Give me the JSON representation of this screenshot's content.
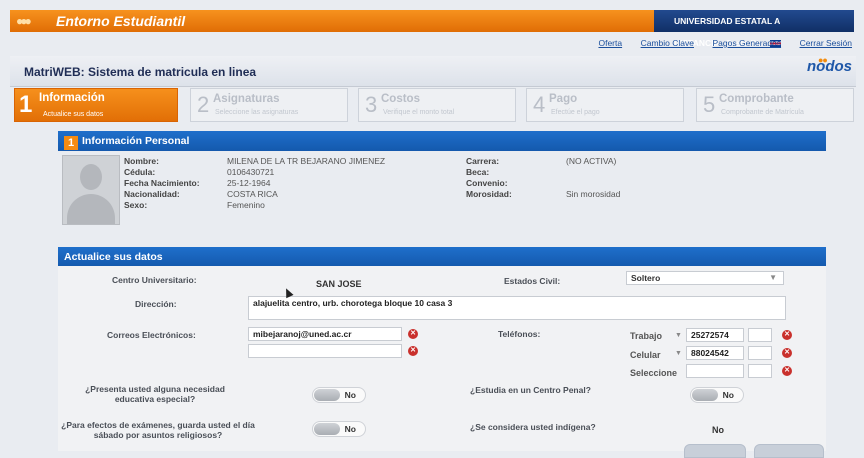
{
  "app": {
    "title": "Entorno Estudiantil",
    "university": "UNIVERSIDAD ESTATAL A DISTANCIA",
    "country": "Costa Rica",
    "brand_orange": "#f08512",
    "brand_blue": "#1a63bd"
  },
  "top_links": [
    "Oferta",
    "Cambio Clave",
    "Pagos Generados",
    "Cerrar Sesión"
  ],
  "header": {
    "title": "MatriWEB: Sistema de matricula en linea",
    "logo": "nodos"
  },
  "steps": [
    {
      "num": "1",
      "label": "Información",
      "sub": "Actualice sus datos",
      "active": true
    },
    {
      "num": "2",
      "label": "Asignaturas",
      "sub": "Seleccione las asignaturas",
      "active": false
    },
    {
      "num": "3",
      "label": "Costos",
      "sub": "Verifique el monto total",
      "active": false
    },
    {
      "num": "4",
      "label": "Pago",
      "sub": "Efectúe el pago",
      "active": false
    },
    {
      "num": "5",
      "label": "Comprobante",
      "sub": "Comprobante de Matrícula",
      "active": false
    }
  ],
  "personal": {
    "section_num": "1",
    "heading": "Información Personal",
    "labels": [
      "Nombre:",
      "Cédula:",
      "Fecha Nacimiento:",
      "Nacionalidad:",
      "Sexo:"
    ],
    "values": [
      "MILENA DE LA TR BEJARANO JIMENEZ",
      "0106430721",
      "25-12-1964",
      "COSTA RICA",
      "Femenino"
    ],
    "right_labels": [
      "Carrera:",
      "Beca:",
      "Convenio:",
      "Morosidad:"
    ],
    "right_values": [
      "(NO ACTIVA)",
      "",
      "",
      "Sin morosidad"
    ]
  },
  "update": {
    "heading": "Actualice sus datos",
    "centro_label": "Centro Universitario:",
    "centro_value": "SAN JOSE",
    "estado_label": "Estados Civil:",
    "estado_value": "Soltero",
    "direccion_label": "Dirección:",
    "direccion_value": "alajuelita centro, urb. chorotega bloque 10 casa 3",
    "correos_label": "Correos Electrónicos:",
    "correo1": "mibejaranoj@uned.ac.cr",
    "correo2": "",
    "telefonos_label": "Teléfonos:",
    "phones": [
      {
        "type": "Trabajo",
        "number": "25272574",
        "ext": ""
      },
      {
        "type": "Celular",
        "number": "88024542",
        "ext": ""
      },
      {
        "type": "Seleccione",
        "number": "",
        "ext": ""
      }
    ],
    "q1": "¿Presenta usted alguna necesidad educativa especial?",
    "q1_value": "No",
    "q2": "¿Estudia en un Centro Penal?",
    "q2_value": "No",
    "q3": "¿Para efectos de exámenes, guarda usted el día sábado por asuntos religiosos?",
    "q3_value": "No",
    "q4": "¿Se considera usted indígena?",
    "q4_value": "No"
  }
}
